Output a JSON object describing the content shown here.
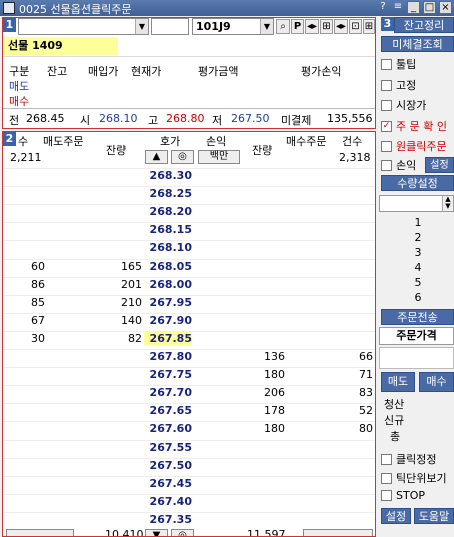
{
  "title": "0025 선물옵션클릭주문",
  "titlebar_buttons": [
    "?",
    "≡",
    "_",
    "□",
    "×"
  ],
  "top": {
    "code": "101J9",
    "btn_p": "P",
    "name": "선물 1409"
  },
  "summary": {
    "headers": [
      "구분",
      "잔고",
      "매입가",
      "현재가",
      "평가금액",
      "평가손익"
    ],
    "rows": [
      "매도",
      "매수"
    ],
    "price_line": {
      "prev_label": "전",
      "prev": "268.45",
      "open_label": "시",
      "open": "268.10",
      "high_label": "고",
      "high": "268.80",
      "low_label": "저",
      "low": "267.50",
      "oi_label": "미결제",
      "oi": "135,556"
    }
  },
  "book": {
    "header": {
      "count_left": "수",
      "sell_order": "매도주문",
      "sell_qty": "잔량",
      "price": "호가",
      "pnl": "손익",
      "pnl_unit": "백만",
      "buy_qty": "잔량",
      "buy_order": "매수주문",
      "count_right": "건수",
      "sell_count_total": "2,211",
      "buy_count_total": "2,318"
    },
    "rows": [
      {
        "price": "268.30",
        "scount": "",
        "sqty": "",
        "bqty": "",
        "bcount": ""
      },
      {
        "price": "268.25",
        "scount": "",
        "sqty": "",
        "bqty": "",
        "bcount": ""
      },
      {
        "price": "268.20",
        "scount": "",
        "sqty": "",
        "bqty": "",
        "bcount": ""
      },
      {
        "price": "268.15",
        "scount": "",
        "sqty": "",
        "bqty": "",
        "bcount": ""
      },
      {
        "price": "268.10",
        "scount": "",
        "sqty": "",
        "bqty": "",
        "bcount": ""
      },
      {
        "price": "268.05",
        "scount": "60",
        "sqty": "165",
        "bqty": "",
        "bcount": ""
      },
      {
        "price": "268.00",
        "scount": "86",
        "sqty": "201",
        "bqty": "",
        "bcount": ""
      },
      {
        "price": "267.95",
        "scount": "85",
        "sqty": "210",
        "bqty": "",
        "bcount": ""
      },
      {
        "price": "267.90",
        "scount": "67",
        "sqty": "140",
        "bqty": "",
        "bcount": ""
      },
      {
        "price": "267.85",
        "scount": "30",
        "sqty": "82",
        "bqty": "",
        "bcount": ""
      },
      {
        "price": "267.80",
        "scount": "",
        "sqty": "",
        "bqty": "136",
        "bcount": "66"
      },
      {
        "price": "267.75",
        "scount": "",
        "sqty": "",
        "bqty": "180",
        "bcount": "71"
      },
      {
        "price": "267.70",
        "scount": "",
        "sqty": "",
        "bqty": "206",
        "bcount": "83"
      },
      {
        "price": "267.65",
        "scount": "",
        "sqty": "",
        "bqty": "178",
        "bcount": "52"
      },
      {
        "price": "267.60",
        "scount": "",
        "sqty": "",
        "bqty": "180",
        "bcount": "80"
      },
      {
        "price": "267.55",
        "scount": "",
        "sqty": "",
        "bqty": "",
        "bcount": ""
      },
      {
        "price": "267.50",
        "scount": "",
        "sqty": "",
        "bqty": "",
        "bcount": ""
      },
      {
        "price": "267.45",
        "scount": "",
        "sqty": "",
        "bqty": "",
        "bcount": ""
      },
      {
        "price": "267.40",
        "scount": "",
        "sqty": "",
        "bqty": "",
        "bcount": ""
      },
      {
        "price": "267.35",
        "scount": "",
        "sqty": "",
        "bqty": "",
        "bcount": ""
      }
    ],
    "footer": {
      "sell_total": "10,410",
      "buy_total": "11,597"
    }
  },
  "side": {
    "section_badge": "3",
    "btn_balance": "잔고정리",
    "btn_unfilled": "미체결조회",
    "checks": [
      {
        "label": "툴팁",
        "checked": false
      },
      {
        "label": "고정",
        "checked": false
      },
      {
        "label": "시장가",
        "checked": false
      },
      {
        "label": "주 문 확 인",
        "checked": true
      },
      {
        "label": "원클릭주문",
        "checked": false
      },
      {
        "label": "손익",
        "checked": false
      }
    ],
    "btn_pnl_setting": "설정",
    "btn_qty_setting": "수량설정",
    "qty_list": [
      "1",
      "2",
      "3",
      "4",
      "5",
      "6"
    ],
    "btn_send": "주문전송",
    "label_order_price": "주문가격",
    "btn_sell": "매도",
    "btn_buy": "매수",
    "order_labels": [
      "청산",
      "신규",
      "총"
    ],
    "bottom_checks": [
      {
        "label": "클릭정정",
        "checked": false
      },
      {
        "label": "틱단위보기",
        "checked": false
      },
      {
        "label": "STOP",
        "checked": false
      }
    ],
    "btn_setting": "설정",
    "btn_help": "도움말"
  },
  "colors": {
    "accent": "#3a64a8",
    "red": "#c00000",
    "price_blue": "#1a237e",
    "highlight": "#ffff99"
  }
}
